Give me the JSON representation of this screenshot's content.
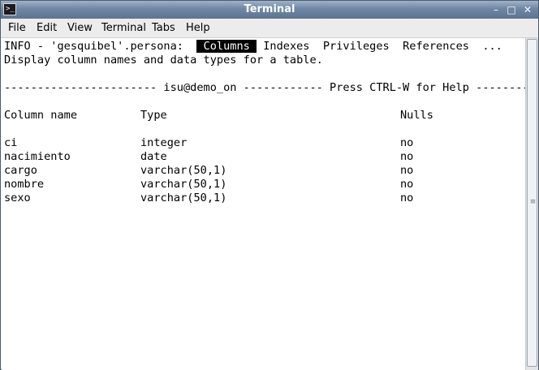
{
  "window": {
    "title": "Terminal",
    "icon": "terminal-icon",
    "icon_glyph": ">_"
  },
  "window_controls": {
    "minimize": "–",
    "maximize": "□",
    "close": "✕"
  },
  "menubar": {
    "items": [
      "File",
      "Edit",
      "View",
      "Terminal",
      "Tabs",
      "Help"
    ]
  },
  "terminal": {
    "info_prefix": "INFO - 'gesquibel'.persona: ",
    "menu_options": [
      "Columns",
      "Indexes",
      "Privileges",
      "References",
      "..."
    ],
    "selected_option": "Columns",
    "description": "Display column names and data types for a table.",
    "status_dashes_left": "----------------------- ",
    "status_user": "isu@demo_on",
    "status_dashes_mid": " ------------ ",
    "status_help": "Press CTRL-W for Help",
    "status_dashes_right": " --------",
    "headers": {
      "column": "Column name",
      "type": "Type",
      "nulls": "Nulls"
    },
    "rows": [
      {
        "column": "ci",
        "type": "integer",
        "nulls": "no"
      },
      {
        "column": "nacimiento",
        "type": "date",
        "nulls": "no"
      },
      {
        "column": "cargo",
        "type": "varchar(50,1)",
        "nulls": "no"
      },
      {
        "column": "nombre",
        "type": "varchar(50,1)",
        "nulls": "no"
      },
      {
        "column": "sexo",
        "type": "varchar(50,1)",
        "nulls": "no"
      }
    ]
  }
}
